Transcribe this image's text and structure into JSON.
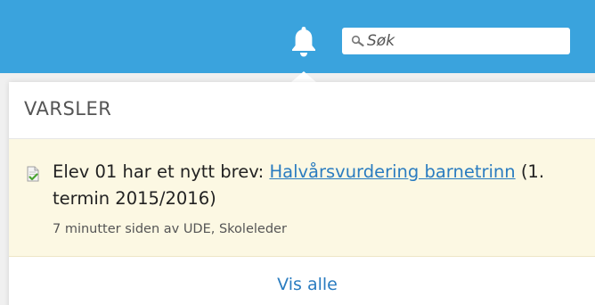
{
  "header": {
    "bell_icon": "bell-icon",
    "search": {
      "icon": "magnifier-icon",
      "placeholder": "Søk",
      "value": ""
    }
  },
  "notifications": {
    "title": "VARSLER",
    "items": [
      {
        "icon": "document-check-icon",
        "text_before": "Elev 01 har et nytt brev: ",
        "link_text": "Halvårsvurdering barnetrinn",
        "text_after": " (1. termin 2015/2016)",
        "meta": "7 minutter siden av UDE, Skoleleder"
      }
    ],
    "show_all_label": "Vis alle"
  },
  "colors": {
    "topbar": "#3aa3dd",
    "highlight": "#fcf8e3",
    "link": "#2a7cc0"
  }
}
